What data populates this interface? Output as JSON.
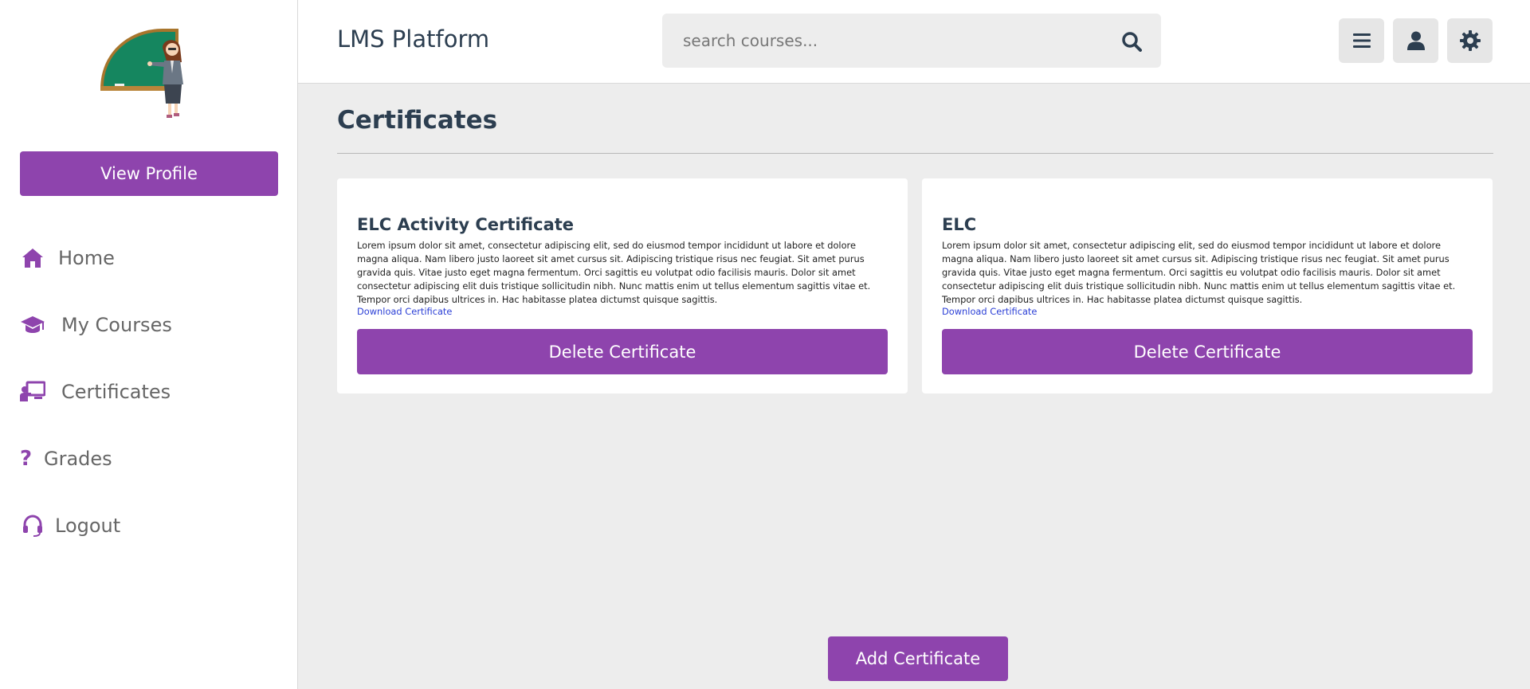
{
  "app": {
    "title": "LMS Platform"
  },
  "search": {
    "placeholder": "search courses..."
  },
  "header": {
    "icons": [
      "menu-icon",
      "user-icon",
      "settings-icon"
    ]
  },
  "sidebar": {
    "view_profile_label": "View Profile",
    "items": [
      {
        "label": "Home",
        "icon": "home-icon"
      },
      {
        "label": "My Courses",
        "icon": "graduation-cap-icon"
      },
      {
        "label": "Certificates",
        "icon": "teacher-board-icon"
      },
      {
        "label": "Grades",
        "icon": "question-icon"
      },
      {
        "label": "Logout",
        "icon": "headset-icon"
      }
    ]
  },
  "main": {
    "page_title": "Certificates",
    "cards": [
      {
        "title": "ELC Activity Certificate",
        "description": "Lorem ipsum dolor sit amet, consectetur adipiscing elit, sed do eiusmod tempor incididunt ut labore et dolore magna aliqua. Nam libero justo laoreet sit amet cursus sit. Adipiscing tristique risus nec feugiat. Sit amet purus gravida quis. Vitae justo eget magna fermentum. Orci sagittis eu volutpat odio facilisis mauris. Dolor sit amet consectetur adipiscing elit duis tristique sollicitudin nibh. Nunc mattis enim ut tellus elementum sagittis vitae et. Tempor orci dapibus ultrices in. Hac habitasse platea dictumst quisque sagittis.",
        "download_label": "Download Certificate",
        "delete_label": "Delete Certificate"
      },
      {
        "title": "ELC",
        "description": "Lorem ipsum dolor sit amet, consectetur adipiscing elit, sed do eiusmod tempor incididunt ut labore et dolore magna aliqua. Nam libero justo laoreet sit amet cursus sit. Adipiscing tristique risus nec feugiat. Sit amet purus gravida quis. Vitae justo eget magna fermentum. Orci sagittis eu volutpat odio facilisis mauris. Dolor sit amet consectetur adipiscing elit duis tristique sollicitudin nibh. Nunc mattis enim ut tellus elementum sagittis vitae et. Tempor orci dapibus ultrices in. Hac habitasse platea dictumst quisque sagittis.",
        "download_label": "Download Certificate",
        "delete_label": "Delete Certificate"
      }
    ],
    "add_label": "Add Certificate"
  },
  "colors": {
    "accent": "#8e44ad",
    "link": "#2b3fd6",
    "text": "#2c3e50",
    "background": "#ededed"
  }
}
